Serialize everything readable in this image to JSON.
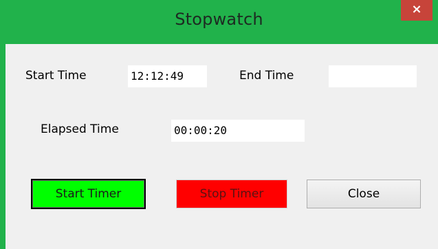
{
  "window": {
    "title": "Stopwatch",
    "close_glyph": "×",
    "accent_color": "#21b24b",
    "close_color": "#c7443a"
  },
  "fields": {
    "start_time_label": "Start Time",
    "start_time_value": "12:12:49",
    "end_time_label": "End Time",
    "end_time_value": "",
    "elapsed_time_label": "Elapsed Time",
    "elapsed_time_value": "00:00:20"
  },
  "buttons": {
    "start_label": "Start Timer",
    "start_color": "#00ff00",
    "stop_label": "Stop Timer",
    "stop_color": "#ff0000",
    "close_label": "Close"
  }
}
